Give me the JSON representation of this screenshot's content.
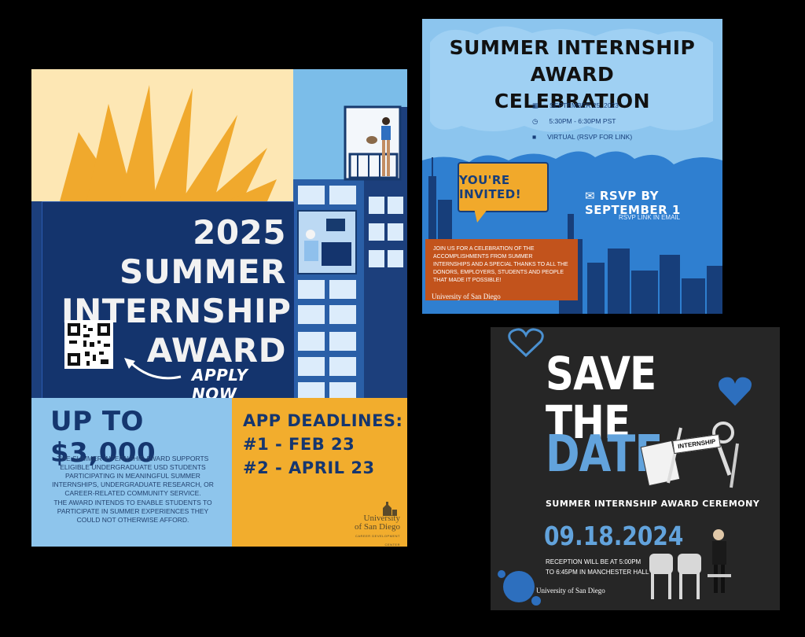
{
  "flyer1": {
    "title_lines": [
      "2025 SUMMER",
      "INTERNSHIP",
      "AWARD"
    ],
    "apply": "APPLY NOW",
    "amount": "UP TO $3,000",
    "desc1": "THE SUMMER INTERNSHIP AWARD SUPPORTS ELIGIBLE UNDERGRADUATE USD STUDENTS PARTICIPATING IN MEANINGFUL SUMMER INTERNSHIPS, UNDERGRADUATE RESEARCH, OR CAREER-RELATED COMMUNITY SERVICE.",
    "desc2": "THE AWARD INTENDS TO ENABLE STUDENTS TO PARTICIPATE IN SUMMER EXPERIENCES THEY COULD NOT OTHERWISE AFFORD.",
    "deadlines_title": "APP DEADLINES:",
    "deadline1": "#1 -  FEB 23",
    "deadline2": "#2 - APRIL 23",
    "logo_line1": "University",
    "logo_line2": "of San Diego",
    "logo_sub": "CAREER DEVELOPMENT CENTER"
  },
  "flyer2": {
    "title_line1": "SUMMER INTERNSHIP AWARD",
    "title_line2": "CELEBRATION",
    "date": "SEPTEMBER 25, 2023",
    "time": "5:30PM - 6:30PM PST",
    "mode": "VIRTUAL (RSVP FOR LINK)",
    "invited": "YOU'RE INVITED!",
    "rsvp": "RSVP BY SEPTEMBER 1",
    "rsvp_sub": "RSVP LINK IN EMAIL",
    "message": "JOIN US FOR A CELEBRATION OF THE ACCOMPLISHMENTS FROM SUMMER INTERNSHIPS AND A SPECIAL THANKS TO ALL THE DONORS, EMPLOYERS, STUDENTS AND PEOPLE THAT MADE IT POSSIBLE!",
    "logo": "University of San Diego"
  },
  "flyer3": {
    "save": "SAVE THE",
    "date_word": "DATE",
    "tag": "INTERNSHIP",
    "ceremony": "SUMMER INTERNSHIP AWARD CEREMONY",
    "date": "09.18.2024",
    "reception_line1": "RECEPTION WILL BE AT 5:00PM",
    "reception_line2": "TO 6:45PM IN MANCHESTER HALL",
    "logo": "University of San Diego"
  },
  "colors": {
    "navy": "#14346d",
    "sky": "#7bbde9",
    "gold": "#f2ad2d",
    "sunburst": "#f0a92d",
    "cream": "#fde7b4",
    "orange": "#c2531c",
    "light_blue": "#62a3dc"
  }
}
